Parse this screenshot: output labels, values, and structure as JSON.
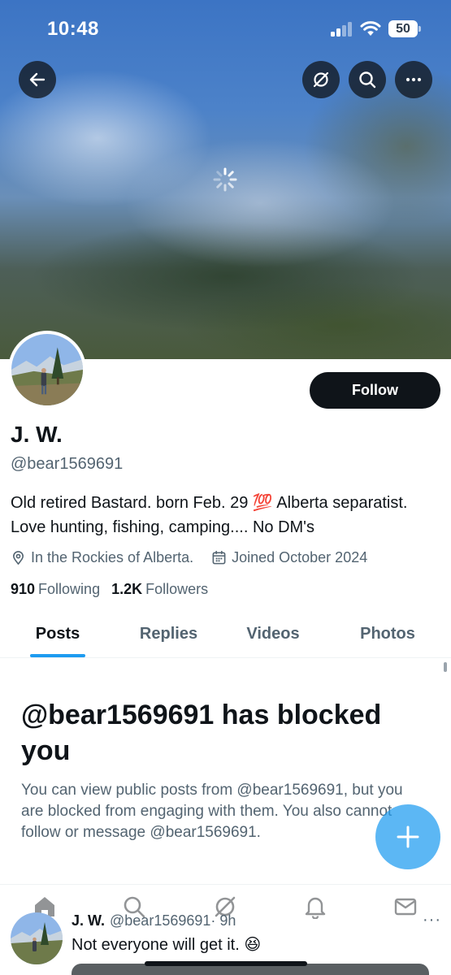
{
  "status_bar": {
    "time": "10:48",
    "battery": "50"
  },
  "header_actions": {
    "back_icon": "arrow-left-icon",
    "grok_icon": "grok-icon",
    "search_icon": "search-icon",
    "more_icon": "more-horizontal-icon"
  },
  "profile": {
    "display_name": "J. W.",
    "handle": "@bear1569691",
    "follow_label": "Follow",
    "bio_line1": "Old retired Bastard. born Feb. 29 💯 Alberta separatist.",
    "bio_line2": "Love hunting, fishing, camping.... No DM's",
    "location": "In the Rockies of Alberta.",
    "joined": "Joined October 2024",
    "following_count": "910",
    "following_label": "Following",
    "followers_count": "1.2K",
    "followers_label": "Followers"
  },
  "tabs": [
    {
      "label": "Posts",
      "active": true
    },
    {
      "label": "Replies",
      "active": false
    },
    {
      "label": "Videos",
      "active": false
    },
    {
      "label": "Photos",
      "active": false
    }
  ],
  "blocked": {
    "title": "@bear1569691 has blocked you",
    "body": "You can view public posts from @bear1569691, but you are blocked from engaging with them. You also cannot follow or message @bear1569691."
  },
  "bottom_nav": [
    "home-icon",
    "search-icon",
    "grok-icon",
    "notifications-icon",
    "messages-icon"
  ],
  "post_peek": {
    "name": "J. W.",
    "handle": "@bear1569691",
    "time": "· 9h",
    "text": "Not everyone will get it. 😆",
    "more": "···"
  },
  "colors": {
    "accent": "#1d9bf0",
    "text_primary": "#0f1419",
    "text_secondary": "#536471",
    "follow_button": "#0f1419"
  }
}
